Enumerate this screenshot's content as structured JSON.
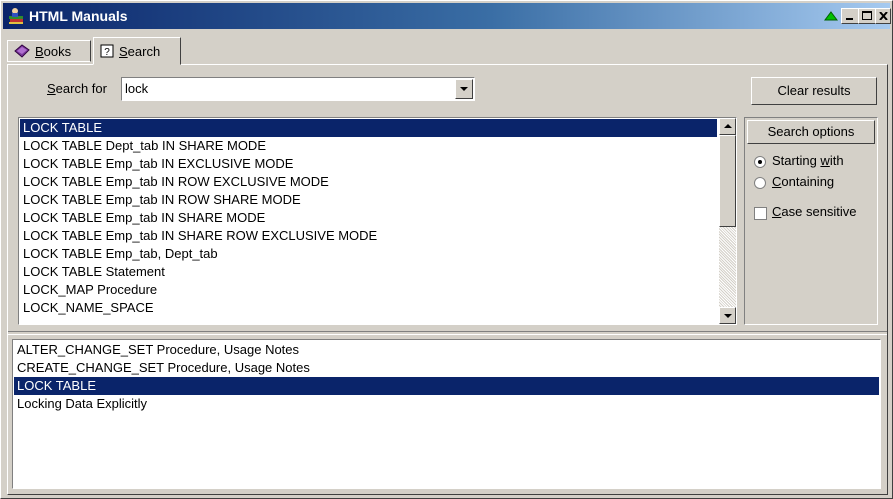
{
  "window": {
    "title": "HTML Manuals"
  },
  "tabs": [
    {
      "label": "Books",
      "accesskey_label": "B",
      "rest": "ooks"
    },
    {
      "label": "Search",
      "accesskey_label": "S",
      "rest": "earch"
    }
  ],
  "search": {
    "label_prefix": "",
    "label_key": "S",
    "label_rest": "earch for",
    "value": "lock",
    "clear_label": "Clear results"
  },
  "options": {
    "header": "Search options",
    "starting_with": "Starting ",
    "starting_with_key": "w",
    "starting_with_rest": "ith",
    "containing_key": "C",
    "containing_rest": "ontaining",
    "case_key": "C",
    "case_rest": "ase sensitive",
    "selected": "starting_with"
  },
  "index_results": [
    "LOCK TABLE",
    "LOCK TABLE Dept_tab IN SHARE MODE",
    "LOCK TABLE Emp_tab IN EXCLUSIVE MODE",
    "LOCK TABLE Emp_tab IN ROW EXCLUSIVE MODE",
    "LOCK TABLE Emp_tab IN ROW SHARE MODE",
    "LOCK TABLE Emp_tab IN SHARE MODE",
    "LOCK TABLE Emp_tab IN SHARE ROW EXCLUSIVE MODE",
    "LOCK TABLE Emp_tab, Dept_tab",
    "LOCK TABLE Statement",
    "LOCK_MAP Procedure",
    "LOCK_NAME_SPACE"
  ],
  "index_selected": 0,
  "topic_results": [
    "ALTER_CHANGE_SET Procedure, Usage Notes",
    "CREATE_CHANGE_SET Procedure, Usage Notes",
    "LOCK TABLE",
    "Locking Data Explicitly"
  ],
  "topic_selected": 2
}
